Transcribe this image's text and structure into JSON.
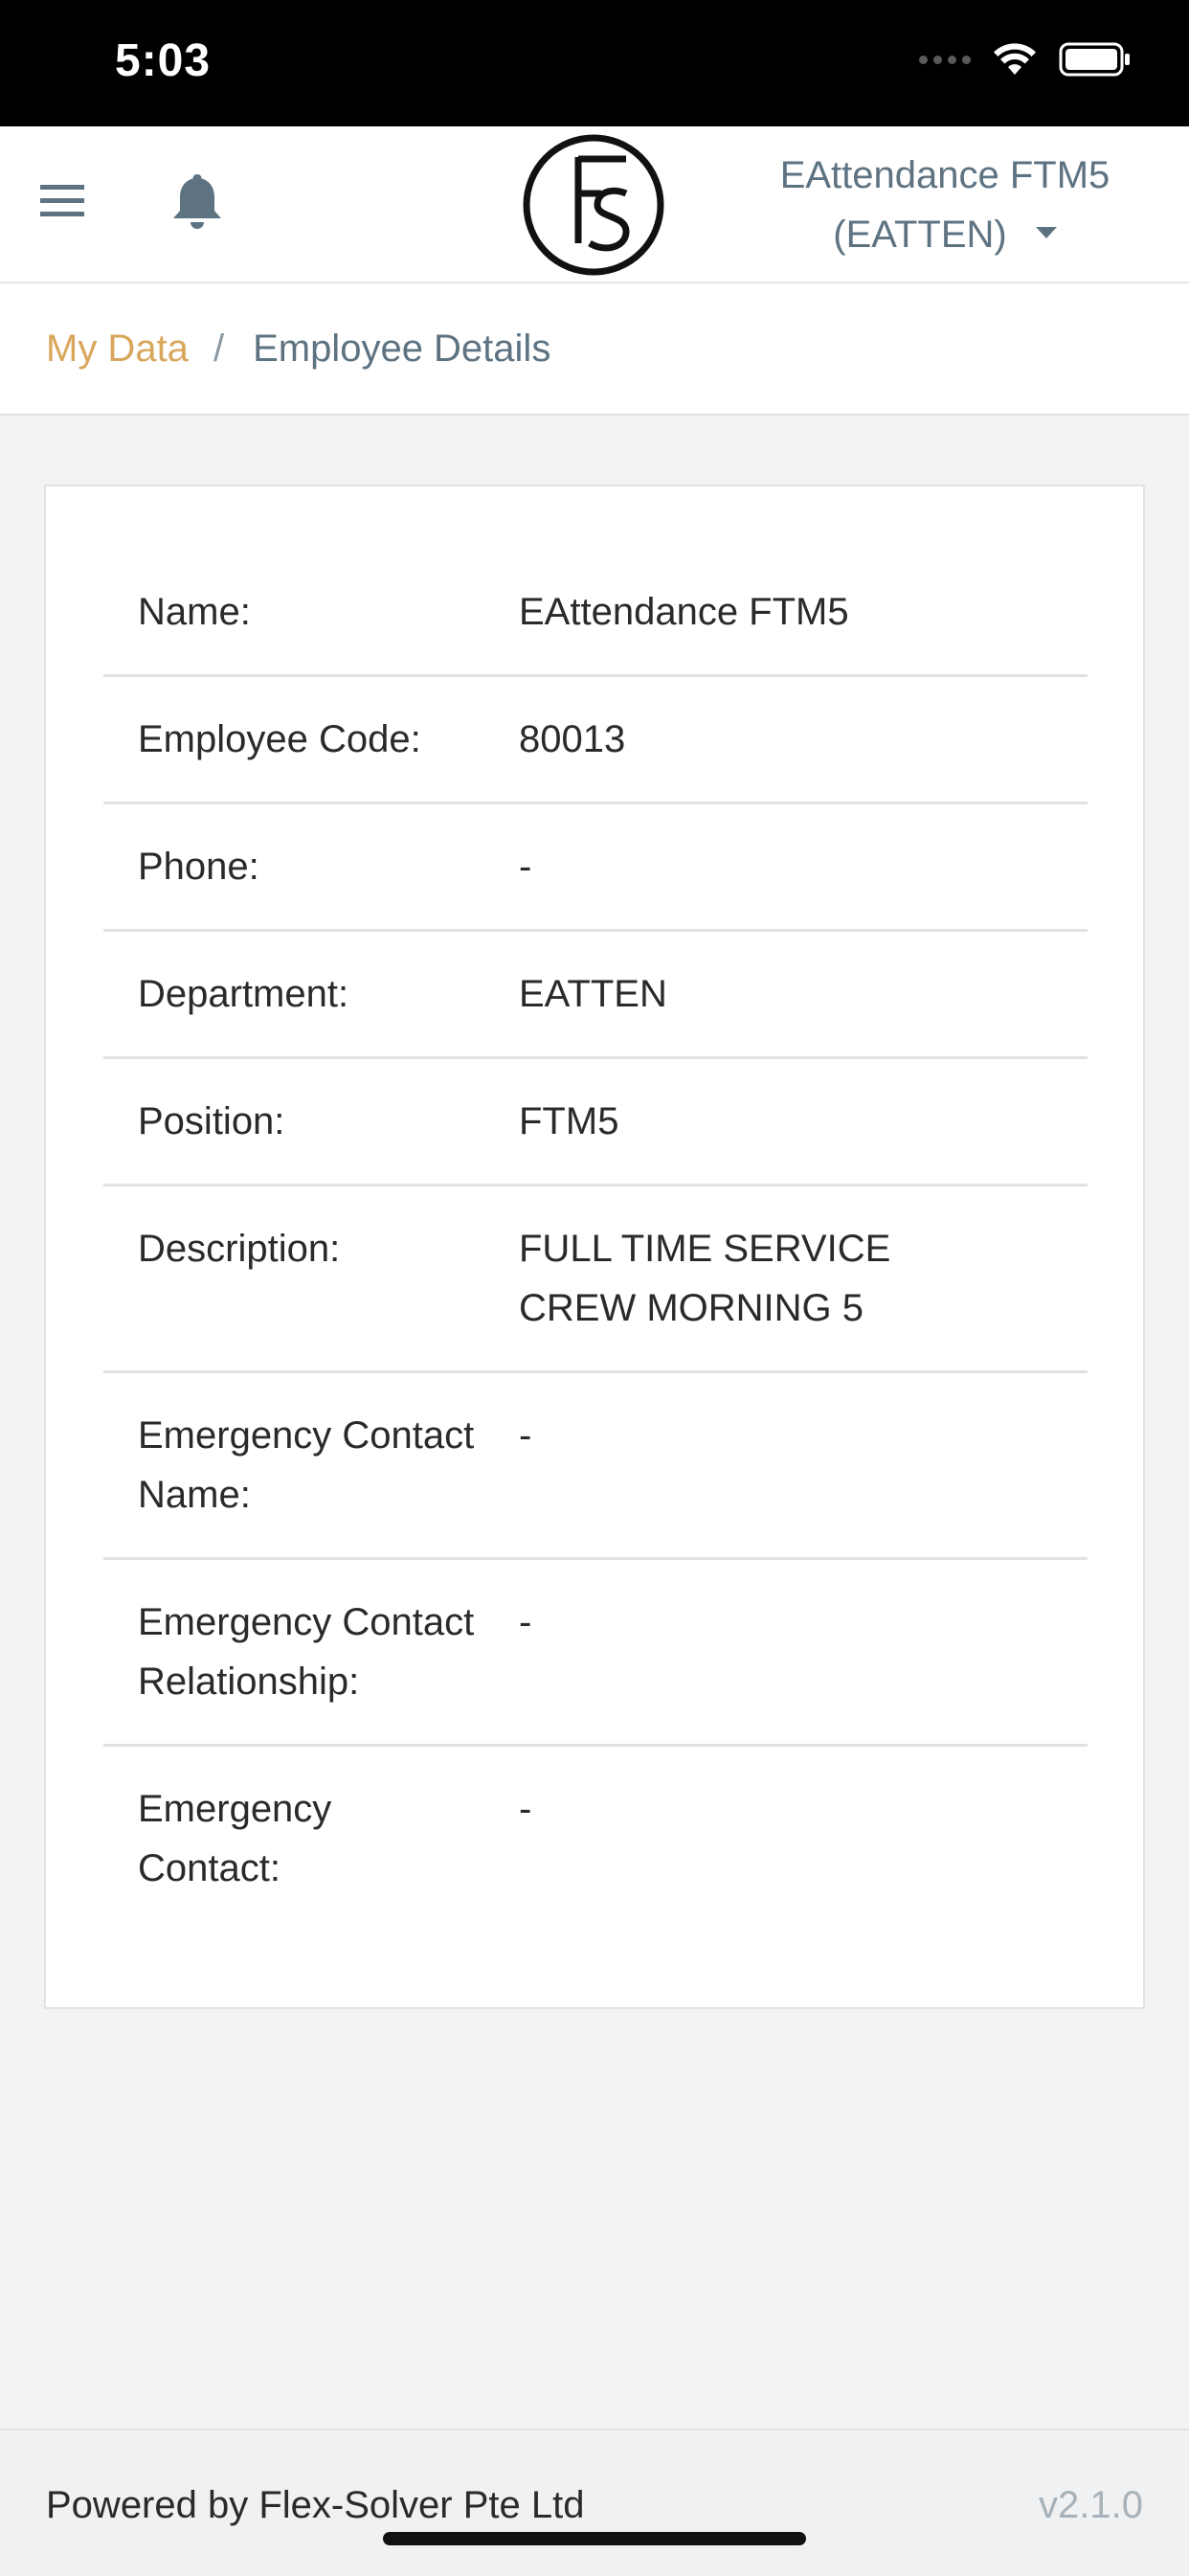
{
  "status_bar": {
    "time": "5:03"
  },
  "header": {
    "menu_icon": "hamburger-menu-icon",
    "bell_icon": "notification-bell-icon",
    "logo": "FS",
    "user_name": "EAttendance FTM5",
    "user_department": "(EATTEN)"
  },
  "breadcrumb": {
    "parent": "My Data",
    "separator": "/",
    "current": "Employee Details"
  },
  "details": [
    {
      "label": "Name:",
      "value": "EAttendance FTM5"
    },
    {
      "label": "Employee Code:",
      "value": "80013"
    },
    {
      "label": "Phone:",
      "value": "-"
    },
    {
      "label": "Department:",
      "value": "EATTEN"
    },
    {
      "label": "Position:",
      "value": "FTM5"
    },
    {
      "label": "Description:",
      "value": "FULL TIME SERVICE CREW MORNING 5"
    },
    {
      "label": "Emergency Contact Name:",
      "value": "-"
    },
    {
      "label": "Emergency Contact Relationship:",
      "value": "-"
    },
    {
      "label": "Emergency Contact:",
      "value": "-"
    }
  ],
  "footer": {
    "powered_by": "Powered by Flex-Solver Pte Ltd",
    "version": "v2.1.0"
  },
  "colors": {
    "accent": "#d9a75b",
    "header_text": "#5d7382",
    "background": "#f3f3f3"
  }
}
